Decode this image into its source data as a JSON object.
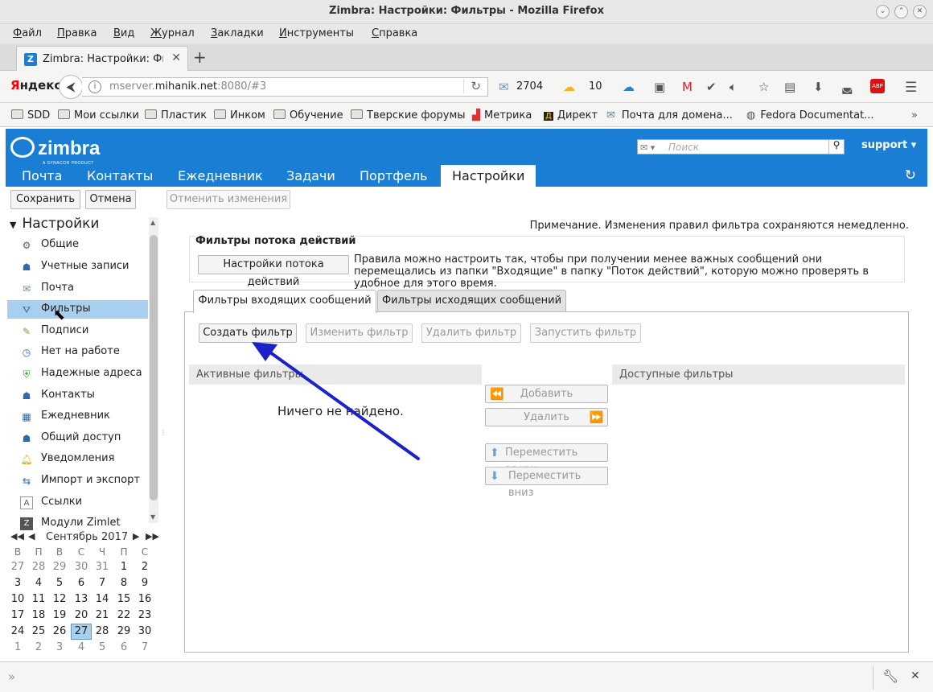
{
  "window": {
    "title": "Zimbra: Настройки: Фильтры - Mozilla Firefox",
    "buttons": [
      "⌄",
      "⌃",
      "✕"
    ]
  },
  "menubar": [
    "Файл",
    "Правка",
    "Вид",
    "Журнал",
    "Закладки",
    "Инструменты",
    "Справка"
  ],
  "tab": {
    "label": "Zimbra: Настройки: Фи",
    "favicon": "Z",
    "close": "✕",
    "new": "+"
  },
  "navbar": {
    "yandex_prefix": "Я",
    "yandex_rest": "ндекс",
    "url_prefix": "mserver.",
    "url_domain": "mihanik.net",
    "url_suffix": ":8080/#3",
    "mail_count": "2704",
    "weather": "10"
  },
  "bookmarks": [
    "SDD",
    "Мои ссылки",
    "Пластик",
    "Инком",
    "Обучение",
    "Тверские форумы",
    "Метрика",
    "Директ",
    "Почта для домена...",
    "Fedora Documentat..."
  ],
  "zimbra": {
    "logo": "zimbra",
    "logo_sub": "A SYNACOR PRODUCT",
    "search_placeholder": "Поиск",
    "user": "support",
    "apps": [
      "Почта",
      "Контакты",
      "Ежедневник",
      "Задачи",
      "Портфель",
      "Настройки"
    ]
  },
  "toolbar": {
    "save": "Сохранить",
    "cancel": "Отмена",
    "revert": "Отменить изменения"
  },
  "tree": {
    "header": "Настройки",
    "items": [
      {
        "label": "Общие",
        "icon": "gear-icon"
      },
      {
        "label": "Учетные записи",
        "icon": "accounts-icon"
      },
      {
        "label": "Почта",
        "icon": "mail-icon"
      },
      {
        "label": "Фильтры",
        "icon": "filter-icon"
      },
      {
        "label": "Подписи",
        "icon": "signature-icon"
      },
      {
        "label": "Нет на работе",
        "icon": "out-of-office-icon"
      },
      {
        "label": "Надежные адреса",
        "icon": "trusted-icon"
      },
      {
        "label": "Контакты",
        "icon": "contacts-icon"
      },
      {
        "label": "Ежедневник",
        "icon": "calendar-icon"
      },
      {
        "label": "Общий доступ",
        "icon": "sharing-icon"
      },
      {
        "label": "Уведомления",
        "icon": "bell-icon"
      },
      {
        "label": "Импорт и экспорт",
        "icon": "import-export-icon"
      },
      {
        "label": "Ссылки",
        "icon": "shortcuts-icon"
      },
      {
        "label": "Модули Zimlet",
        "icon": "zimlet-icon"
      }
    ]
  },
  "calendar": {
    "month": "Сентябрь 2017",
    "weekdays": [
      "В",
      "П",
      "В",
      "С",
      "Ч",
      "П",
      "С"
    ],
    "weeks": [
      [
        "27",
        "28",
        "29",
        "30",
        "31",
        "1",
        "2"
      ],
      [
        "3",
        "4",
        "5",
        "6",
        "7",
        "8",
        "9"
      ],
      [
        "10",
        "11",
        "12",
        "13",
        "14",
        "15",
        "16"
      ],
      [
        "17",
        "18",
        "19",
        "20",
        "21",
        "22",
        "23"
      ],
      [
        "24",
        "25",
        "26",
        "27",
        "28",
        "29",
        "30"
      ],
      [
        "1",
        "2",
        "3",
        "4",
        "5",
        "6",
        "7"
      ]
    ],
    "today": "27"
  },
  "main": {
    "note": "Примечание. Изменения правил фильтра сохраняются немедленно.",
    "activity_legend": "Фильтры потока действий",
    "activity_button": "Настройки потока действий",
    "activity_desc": "Правила можно настроить так, чтобы при получении менее важных сообщений они перемещались из папки \"Входящие\" в папку \"Поток действий\", которую можно проверять в удобное для этого время.",
    "tabs": [
      "Фильтры входящих сообщений",
      "Фильтры исходящих сообщений"
    ],
    "buttons": {
      "create": "Создать фильтр",
      "edit": "Изменить фильтр",
      "delete": "Удалить фильтр",
      "run": "Запустить фильтр"
    },
    "active_header": "Активные фильтры",
    "available_header": "Доступные фильтры",
    "empty": "Ничего не найдено.",
    "move": {
      "add": "Добавить",
      "remove": "Удалить",
      "up": "Переместить вверх",
      "down": "Переместить вниз"
    }
  },
  "colors": {
    "zimbra_blue": "#1a7fd4",
    "selection": "#a9cfee",
    "annotation_arrow": "#1a22c8"
  }
}
